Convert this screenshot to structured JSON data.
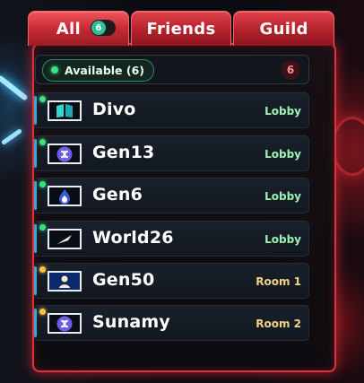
{
  "tabs": {
    "all_label": "All",
    "all_badge": "6",
    "friends_label": "Friends",
    "guild_label": "Guild"
  },
  "available": {
    "label": "Available (6)",
    "count": "6"
  },
  "players": [
    {
      "name": "Divo",
      "location": "Lobby",
      "status_color": "#3be07f",
      "icon": "book-icon"
    },
    {
      "name": "Gen13",
      "location": "Lobby",
      "status_color": "#3be07f",
      "icon": "hex-token-icon"
    },
    {
      "name": "Gen6",
      "location": "Lobby",
      "status_color": "#3be07f",
      "icon": "flame-icon"
    },
    {
      "name": "World26",
      "location": "Lobby",
      "status_color": "#3be07f",
      "icon": "bird-icon"
    },
    {
      "name": "Gen50",
      "location": "Room 1",
      "status_color": "#f5c542",
      "icon": "person-icon"
    },
    {
      "name": "Sunamy",
      "location": "Room 2",
      "status_color": "#f5c542",
      "icon": "hex-token-icon"
    }
  ]
}
